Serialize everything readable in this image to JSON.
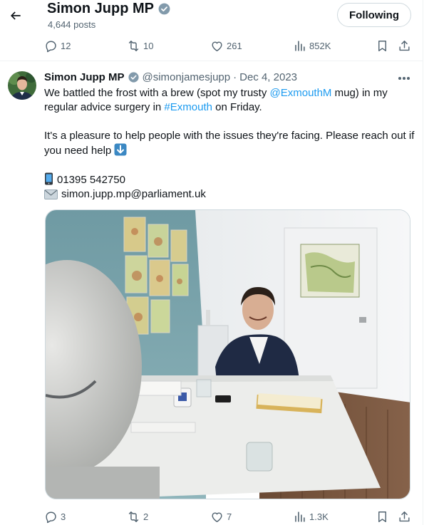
{
  "header": {
    "name": "Simon Jupp MP",
    "post_count": "4,644 posts",
    "follow_label": "Following"
  },
  "prev_tweet": {
    "replies": "12",
    "reposts": "10",
    "likes": "261",
    "views": "852K"
  },
  "tweet": {
    "display_name": "Simon Jupp MP",
    "handle": "@simonjamesjupp",
    "separator": "·",
    "date": "Dec 4, 2023",
    "line1_pre": "We battled the frost with a brew (spot my trusty ",
    "mention": "@ExmouthM",
    "line1_post": " mug) in my",
    "line2_pre": "regular advice surgery in ",
    "hashtag": "#Exmouth",
    "line2_post": " on Friday.",
    "para2": "It's a pleasure to help people with the issues they're facing. Please reach out if you need help",
    "phone": "01395 542750",
    "email": "simon.jupp.mp@parliament.uk",
    "replies": "3",
    "reposts": "2",
    "likes": "7",
    "views": "1.3K"
  },
  "colors": {
    "accent": "#1d9bf0",
    "muted": "#536471",
    "border": "#cfd9de",
    "verified": "#829aab"
  },
  "icons": [
    "back-arrow-icon",
    "verified-badge-icon",
    "reply-icon",
    "repost-icon",
    "like-icon",
    "views-icon",
    "bookmark-icon",
    "share-icon",
    "more-icon",
    "down-arrow-emoji-icon",
    "phone-emoji-icon",
    "envelope-emoji-icon"
  ]
}
